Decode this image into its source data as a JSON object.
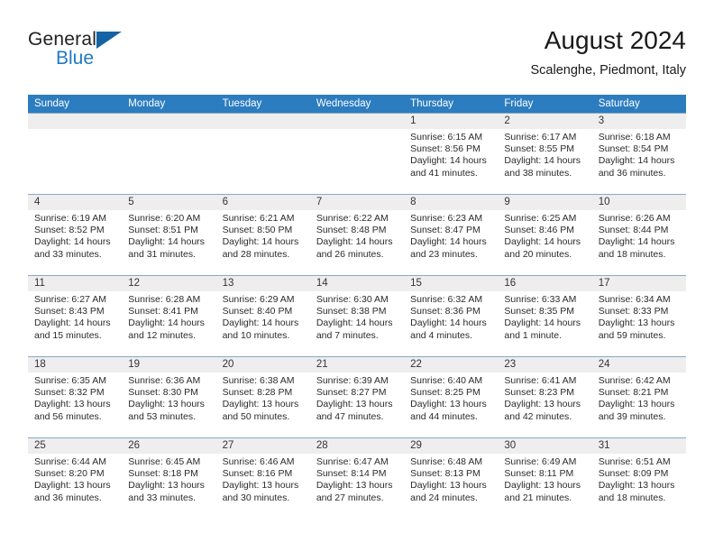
{
  "brand": {
    "name_part1": "General",
    "name_part2": "Blue",
    "flag_icon": "triangle-flag-icon"
  },
  "header": {
    "title": "August 2024",
    "location": "Scalenghe, Piedmont, Italy"
  },
  "colors": {
    "header_blue": "#2c7cc0",
    "brand_blue": "#1f7ac4",
    "flag_blue": "#1464a5",
    "day_band_gray": "#eeeeee",
    "row_divider": "#89a8c4"
  },
  "weekday_headers": [
    "Sunday",
    "Monday",
    "Tuesday",
    "Wednesday",
    "Thursday",
    "Friday",
    "Saturday"
  ],
  "weeks": [
    [
      {
        "day": "",
        "sunrise": "",
        "sunset": "",
        "daylight_line1": "",
        "daylight_line2": ""
      },
      {
        "day": "",
        "sunrise": "",
        "sunset": "",
        "daylight_line1": "",
        "daylight_line2": ""
      },
      {
        "day": "",
        "sunrise": "",
        "sunset": "",
        "daylight_line1": "",
        "daylight_line2": ""
      },
      {
        "day": "",
        "sunrise": "",
        "sunset": "",
        "daylight_line1": "",
        "daylight_line2": ""
      },
      {
        "day": "1",
        "sunrise": "Sunrise: 6:15 AM",
        "sunset": "Sunset: 8:56 PM",
        "daylight_line1": "Daylight: 14 hours",
        "daylight_line2": "and 41 minutes."
      },
      {
        "day": "2",
        "sunrise": "Sunrise: 6:17 AM",
        "sunset": "Sunset: 8:55 PM",
        "daylight_line1": "Daylight: 14 hours",
        "daylight_line2": "and 38 minutes."
      },
      {
        "day": "3",
        "sunrise": "Sunrise: 6:18 AM",
        "sunset": "Sunset: 8:54 PM",
        "daylight_line1": "Daylight: 14 hours",
        "daylight_line2": "and 36 minutes."
      }
    ],
    [
      {
        "day": "4",
        "sunrise": "Sunrise: 6:19 AM",
        "sunset": "Sunset: 8:52 PM",
        "daylight_line1": "Daylight: 14 hours",
        "daylight_line2": "and 33 minutes."
      },
      {
        "day": "5",
        "sunrise": "Sunrise: 6:20 AM",
        "sunset": "Sunset: 8:51 PM",
        "daylight_line1": "Daylight: 14 hours",
        "daylight_line2": "and 31 minutes."
      },
      {
        "day": "6",
        "sunrise": "Sunrise: 6:21 AM",
        "sunset": "Sunset: 8:50 PM",
        "daylight_line1": "Daylight: 14 hours",
        "daylight_line2": "and 28 minutes."
      },
      {
        "day": "7",
        "sunrise": "Sunrise: 6:22 AM",
        "sunset": "Sunset: 8:48 PM",
        "daylight_line1": "Daylight: 14 hours",
        "daylight_line2": "and 26 minutes."
      },
      {
        "day": "8",
        "sunrise": "Sunrise: 6:23 AM",
        "sunset": "Sunset: 8:47 PM",
        "daylight_line1": "Daylight: 14 hours",
        "daylight_line2": "and 23 minutes."
      },
      {
        "day": "9",
        "sunrise": "Sunrise: 6:25 AM",
        "sunset": "Sunset: 8:46 PM",
        "daylight_line1": "Daylight: 14 hours",
        "daylight_line2": "and 20 minutes."
      },
      {
        "day": "10",
        "sunrise": "Sunrise: 6:26 AM",
        "sunset": "Sunset: 8:44 PM",
        "daylight_line1": "Daylight: 14 hours",
        "daylight_line2": "and 18 minutes."
      }
    ],
    [
      {
        "day": "11",
        "sunrise": "Sunrise: 6:27 AM",
        "sunset": "Sunset: 8:43 PM",
        "daylight_line1": "Daylight: 14 hours",
        "daylight_line2": "and 15 minutes."
      },
      {
        "day": "12",
        "sunrise": "Sunrise: 6:28 AM",
        "sunset": "Sunset: 8:41 PM",
        "daylight_line1": "Daylight: 14 hours",
        "daylight_line2": "and 12 minutes."
      },
      {
        "day": "13",
        "sunrise": "Sunrise: 6:29 AM",
        "sunset": "Sunset: 8:40 PM",
        "daylight_line1": "Daylight: 14 hours",
        "daylight_line2": "and 10 minutes."
      },
      {
        "day": "14",
        "sunrise": "Sunrise: 6:30 AM",
        "sunset": "Sunset: 8:38 PM",
        "daylight_line1": "Daylight: 14 hours",
        "daylight_line2": "and 7 minutes."
      },
      {
        "day": "15",
        "sunrise": "Sunrise: 6:32 AM",
        "sunset": "Sunset: 8:36 PM",
        "daylight_line1": "Daylight: 14 hours",
        "daylight_line2": "and 4 minutes."
      },
      {
        "day": "16",
        "sunrise": "Sunrise: 6:33 AM",
        "sunset": "Sunset: 8:35 PM",
        "daylight_line1": "Daylight: 14 hours",
        "daylight_line2": "and 1 minute."
      },
      {
        "day": "17",
        "sunrise": "Sunrise: 6:34 AM",
        "sunset": "Sunset: 8:33 PM",
        "daylight_line1": "Daylight: 13 hours",
        "daylight_line2": "and 59 minutes."
      }
    ],
    [
      {
        "day": "18",
        "sunrise": "Sunrise: 6:35 AM",
        "sunset": "Sunset: 8:32 PM",
        "daylight_line1": "Daylight: 13 hours",
        "daylight_line2": "and 56 minutes."
      },
      {
        "day": "19",
        "sunrise": "Sunrise: 6:36 AM",
        "sunset": "Sunset: 8:30 PM",
        "daylight_line1": "Daylight: 13 hours",
        "daylight_line2": "and 53 minutes."
      },
      {
        "day": "20",
        "sunrise": "Sunrise: 6:38 AM",
        "sunset": "Sunset: 8:28 PM",
        "daylight_line1": "Daylight: 13 hours",
        "daylight_line2": "and 50 minutes."
      },
      {
        "day": "21",
        "sunrise": "Sunrise: 6:39 AM",
        "sunset": "Sunset: 8:27 PM",
        "daylight_line1": "Daylight: 13 hours",
        "daylight_line2": "and 47 minutes."
      },
      {
        "day": "22",
        "sunrise": "Sunrise: 6:40 AM",
        "sunset": "Sunset: 8:25 PM",
        "daylight_line1": "Daylight: 13 hours",
        "daylight_line2": "and 44 minutes."
      },
      {
        "day": "23",
        "sunrise": "Sunrise: 6:41 AM",
        "sunset": "Sunset: 8:23 PM",
        "daylight_line1": "Daylight: 13 hours",
        "daylight_line2": "and 42 minutes."
      },
      {
        "day": "24",
        "sunrise": "Sunrise: 6:42 AM",
        "sunset": "Sunset: 8:21 PM",
        "daylight_line1": "Daylight: 13 hours",
        "daylight_line2": "and 39 minutes."
      }
    ],
    [
      {
        "day": "25",
        "sunrise": "Sunrise: 6:44 AM",
        "sunset": "Sunset: 8:20 PM",
        "daylight_line1": "Daylight: 13 hours",
        "daylight_line2": "and 36 minutes."
      },
      {
        "day": "26",
        "sunrise": "Sunrise: 6:45 AM",
        "sunset": "Sunset: 8:18 PM",
        "daylight_line1": "Daylight: 13 hours",
        "daylight_line2": "and 33 minutes."
      },
      {
        "day": "27",
        "sunrise": "Sunrise: 6:46 AM",
        "sunset": "Sunset: 8:16 PM",
        "daylight_line1": "Daylight: 13 hours",
        "daylight_line2": "and 30 minutes."
      },
      {
        "day": "28",
        "sunrise": "Sunrise: 6:47 AM",
        "sunset": "Sunset: 8:14 PM",
        "daylight_line1": "Daylight: 13 hours",
        "daylight_line2": "and 27 minutes."
      },
      {
        "day": "29",
        "sunrise": "Sunrise: 6:48 AM",
        "sunset": "Sunset: 8:13 PM",
        "daylight_line1": "Daylight: 13 hours",
        "daylight_line2": "and 24 minutes."
      },
      {
        "day": "30",
        "sunrise": "Sunrise: 6:49 AM",
        "sunset": "Sunset: 8:11 PM",
        "daylight_line1": "Daylight: 13 hours",
        "daylight_line2": "and 21 minutes."
      },
      {
        "day": "31",
        "sunrise": "Sunrise: 6:51 AM",
        "sunset": "Sunset: 8:09 PM",
        "daylight_line1": "Daylight: 13 hours",
        "daylight_line2": "and 18 minutes."
      }
    ]
  ]
}
